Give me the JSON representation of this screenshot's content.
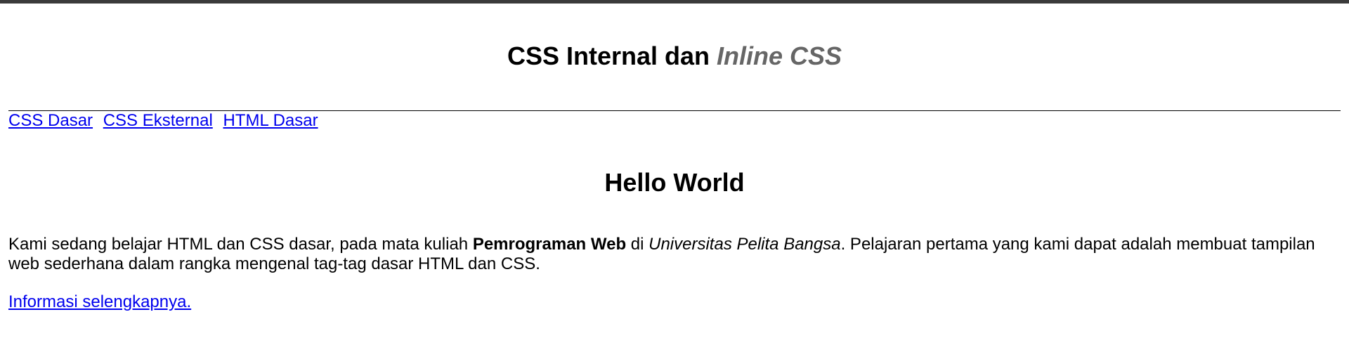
{
  "header": {
    "title_main": "CSS Internal dan ",
    "title_emphasis": "Inline CSS"
  },
  "nav": {
    "links": [
      {
        "label": "CSS Dasar"
      },
      {
        "label": "CSS Eksternal"
      },
      {
        "label": "HTML Dasar"
      }
    ]
  },
  "main": {
    "heading": "Hello World",
    "paragraph": {
      "part1": "Kami sedang belajar HTML dan CSS dasar, pada mata kuliah ",
      "course": "Pemrograman Web",
      "part2": " di ",
      "university": "Universitas Pelita Bangsa",
      "part3": ". Pelajaran pertama yang kami dapat adalah membuat tampilan web sederhana dalam rangka mengenal tag-tag dasar HTML dan CSS."
    },
    "more_link": "Informasi selengkapnya."
  },
  "colors": {
    "top_bar": "#3b3b3b",
    "link": "#0000ee",
    "title_emphasis": "#666666"
  }
}
